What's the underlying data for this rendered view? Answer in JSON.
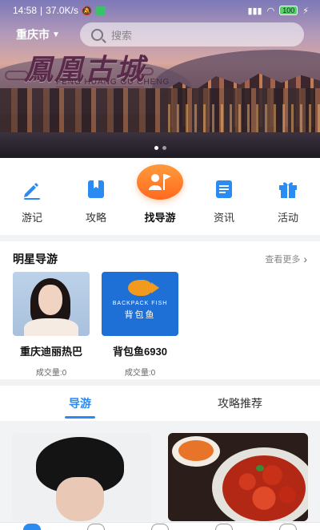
{
  "status_bar": {
    "time": "14:58",
    "net_speed": "37.0K/s",
    "battery": "100"
  },
  "header": {
    "city": "重庆市",
    "search_placeholder": "搜索"
  },
  "banner": {
    "title": "鳳凰古城",
    "pinyin": "FENG HUANG GU CHENG",
    "slide_count": 2,
    "active_slide": 1
  },
  "nav": {
    "items": [
      {
        "label": "游记",
        "icon": "pen-icon"
      },
      {
        "label": "攻略",
        "icon": "book-icon"
      },
      {
        "label": "找导游",
        "icon": "guide-flag-icon"
      },
      {
        "label": "资讯",
        "icon": "news-icon"
      },
      {
        "label": "活动",
        "icon": "gift-icon"
      }
    ],
    "active_index": 2
  },
  "star_guides": {
    "title": "明星导游",
    "more_label": "查看更多",
    "items": [
      {
        "name": "重庆迪丽热巴",
        "deals": "成交量:0"
      },
      {
        "name": "背包鱼6930",
        "deals": "成交量:0",
        "logo_en": "BACKPACK FISH",
        "logo_cn": "背包鱼"
      }
    ]
  },
  "tabs": {
    "items": [
      "导游",
      "攻略推荐"
    ],
    "active_index": 0
  },
  "colors": {
    "accent": "#2a8bf2",
    "nav_icon": "#2a8bf2",
    "highlight": "#ff7a28"
  }
}
